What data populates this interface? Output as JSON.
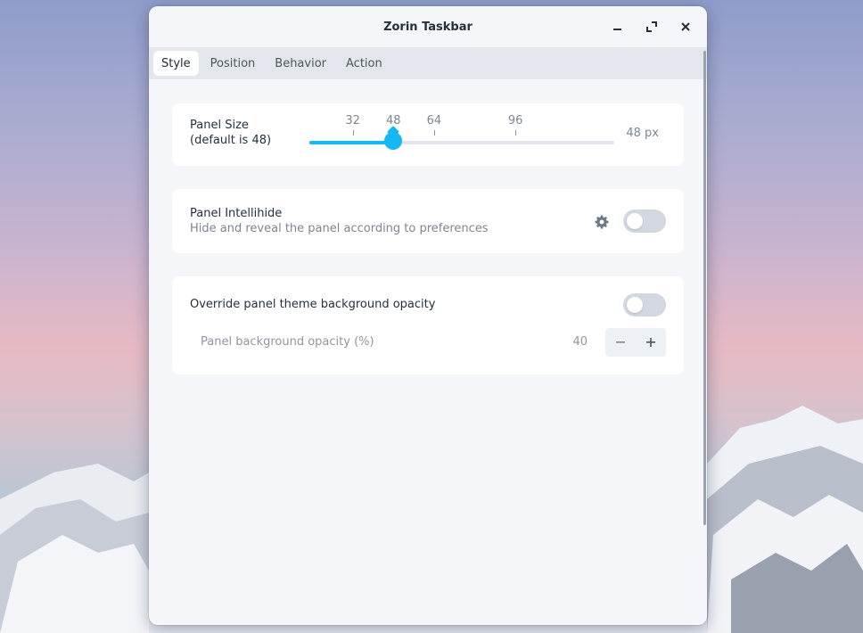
{
  "window": {
    "title": "Zorin Taskbar"
  },
  "tabs": [
    {
      "label": "Style",
      "active": true
    },
    {
      "label": "Position",
      "active": false
    },
    {
      "label": "Behavior",
      "active": false
    },
    {
      "label": "Action",
      "active": false
    }
  ],
  "panel_size": {
    "label": "Panel Size",
    "sublabel": "(default is 48)",
    "ticks": [
      "32",
      "48",
      "64",
      "96"
    ],
    "value": 48,
    "min": 16,
    "max": 128,
    "value_text": "48 px"
  },
  "intellihide": {
    "label": "Panel Intellihide",
    "description": "Hide and reveal the panel according to preferences",
    "enabled": false
  },
  "opacity": {
    "label": "Override panel theme background opacity",
    "enabled": false,
    "sub_label": "Panel background opacity (%)",
    "value": "40"
  },
  "colors": {
    "accent": "#14b8f5",
    "toggle_off": "#d3d8e0"
  }
}
